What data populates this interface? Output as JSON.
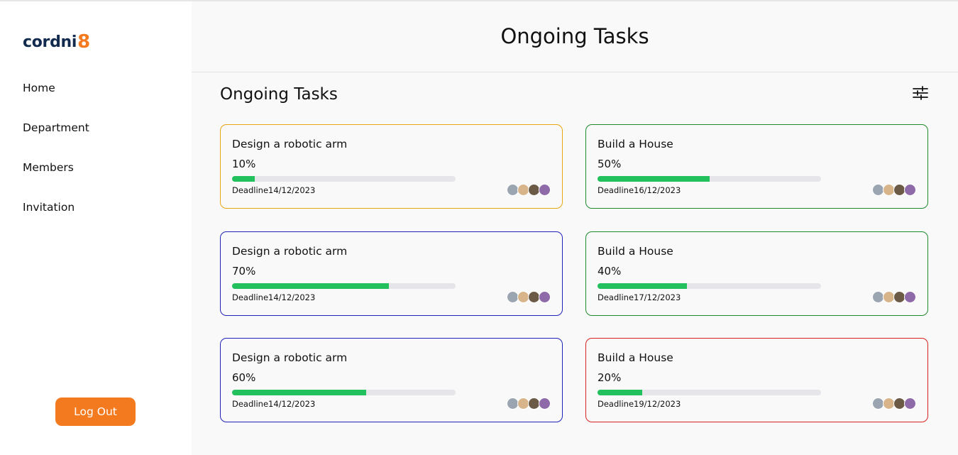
{
  "brand": {
    "name": "cordni",
    "suffix": "8",
    "accent": "#f47a20",
    "dark": "#122a4d"
  },
  "sidebar": {
    "items": [
      {
        "label": "Home"
      },
      {
        "label": "Department"
      },
      {
        "label": "Members"
      },
      {
        "label": "Invitation"
      }
    ],
    "logout_label": "Log Out"
  },
  "header": {
    "title": "Ongoing Tasks"
  },
  "section": {
    "title": "Ongoing Tasks",
    "filter_icon": "sliders-icon"
  },
  "deadline_label": "Deadline",
  "tasks": [
    {
      "title": "Design a robotic arm",
      "progress": "10%",
      "progress_value": 10,
      "deadline": "14/12/2023",
      "border": "#e8a615"
    },
    {
      "title": "Build a House",
      "progress": "50%",
      "progress_value": 50,
      "deadline": "16/12/2023",
      "border": "#1f8a2b"
    },
    {
      "title": "Design a robotic arm",
      "progress": "70%",
      "progress_value": 70,
      "deadline": "14/12/2023",
      "border": "#1f24b8"
    },
    {
      "title": "Build a House",
      "progress": "40%",
      "progress_value": 40,
      "deadline": "17/12/2023",
      "border": "#1f8a2b"
    },
    {
      "title": "Design a robotic arm",
      "progress": "60%",
      "progress_value": 60,
      "deadline": "14/12/2023",
      "border": "#1f24b8"
    },
    {
      "title": "Build a House",
      "progress": "20%",
      "progress_value": 20,
      "deadline": "19/12/2023",
      "border": "#d62222"
    }
  ],
  "avatar_colors": [
    "#9aa5b1",
    "#d8b48a",
    "#6b5a45",
    "#8e6aa8"
  ],
  "progress_color": "#22c15e"
}
